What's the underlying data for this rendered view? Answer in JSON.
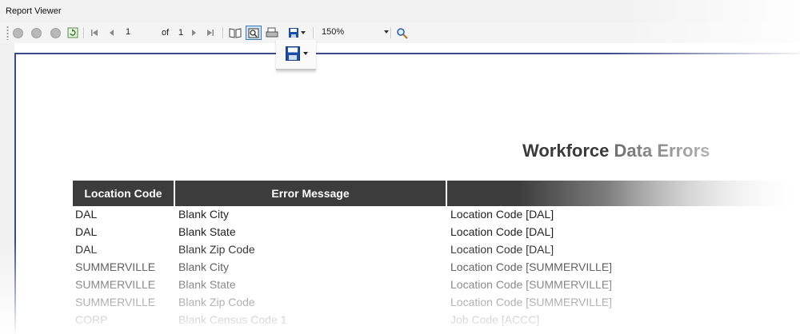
{
  "window": {
    "title": "Report Viewer"
  },
  "toolbar": {
    "page_current": "1",
    "page_of_label": "of",
    "page_total": "1",
    "zoom": "150%",
    "icons": [
      "back-icon",
      "forward-icon",
      "stop-icon",
      "refresh-icon",
      "first-page-icon",
      "previous-page-icon",
      "next-page-icon",
      "last-page-icon",
      "document-map-icon",
      "print-layout-icon",
      "page-setup-icon",
      "export-icon",
      "find-icon"
    ]
  },
  "report": {
    "title_part1": "Workforce",
    "title_part2": "Data Errors",
    "columns": [
      "Location Code",
      "Error Message",
      ""
    ],
    "rows": [
      [
        "DAL",
        "Blank City",
        "Location Code [DAL]"
      ],
      [
        "DAL",
        "Blank State",
        "Location Code [DAL]"
      ],
      [
        "DAL",
        "Blank Zip Code",
        "Location Code [DAL]"
      ],
      [
        "SUMMERVILLE",
        "Blank City",
        "Location Code [SUMMERVILLE]"
      ],
      [
        "SUMMERVILLE",
        "Blank State",
        "Location Code [SUMMERVILLE]"
      ],
      [
        "SUMMERVILLE",
        "Blank Zip Code",
        "Location Code [SUMMERVILLE]"
      ],
      [
        "CORP",
        "Blank Census Code 1",
        "Job Code [ACCC]"
      ]
    ]
  },
  "colors": {
    "header_bg": "#3c3c3c",
    "frame_border": "#3b4a8c",
    "save_icon": "#1e4fa8"
  }
}
